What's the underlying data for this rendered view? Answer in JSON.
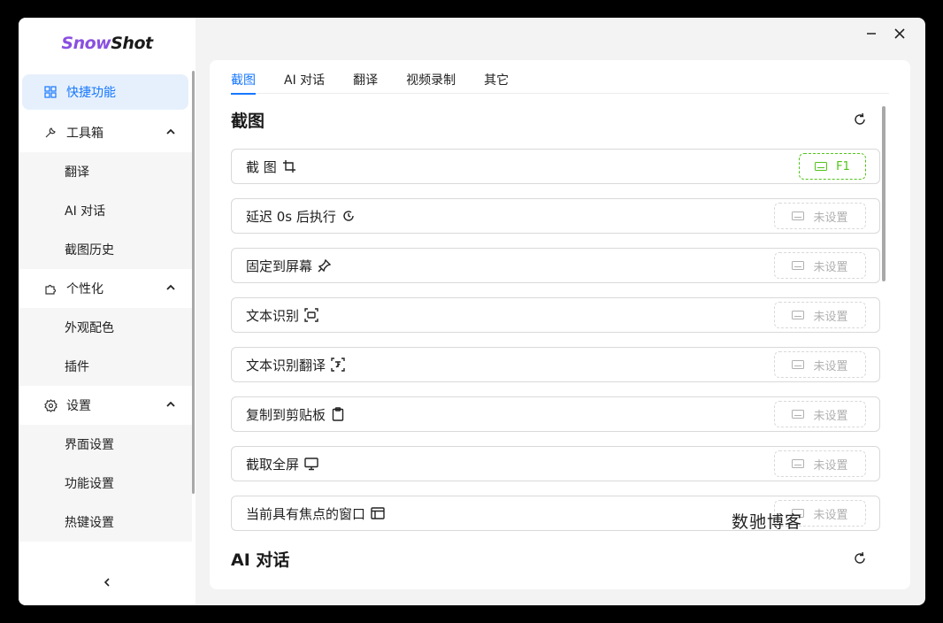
{
  "app": {
    "logo_part1": "Snow",
    "logo_part2": "Shot"
  },
  "sidebar": {
    "items": [
      {
        "label": "快捷功能",
        "icon": "grid-icon",
        "active": true
      },
      {
        "label": "工具箱",
        "icon": "wrench-icon",
        "expanded": true,
        "children": [
          "翻译",
          "AI 对话",
          "截图历史"
        ]
      },
      {
        "label": "个性化",
        "icon": "puzzle-icon",
        "expanded": true,
        "children": [
          "外观配色",
          "插件"
        ]
      },
      {
        "label": "设置",
        "icon": "gear-icon",
        "expanded": true,
        "children": [
          "界面设置",
          "功能设置",
          "热键设置"
        ]
      }
    ]
  },
  "tabs": [
    "截图",
    "AI 对话",
    "翻译",
    "视频录制",
    "其它"
  ],
  "sections": [
    {
      "title": "截图",
      "rows": [
        {
          "label": "截 图",
          "icon": "crop-icon",
          "hotkey": "F1",
          "set": true
        },
        {
          "label": "延迟 0s 后执行",
          "icon": "clock-icon",
          "hotkey": "未设置",
          "set": false
        },
        {
          "label": "固定到屏幕",
          "icon": "pin-icon",
          "hotkey": "未设置",
          "set": false
        },
        {
          "label": "文本识别",
          "icon": "scan-text-icon",
          "hotkey": "未设置",
          "set": false
        },
        {
          "label": "文本识别翻译",
          "icon": "scan-translate-icon",
          "hotkey": "未设置",
          "set": false
        },
        {
          "label": "复制到剪贴板",
          "icon": "clipboard-icon",
          "hotkey": "未设置",
          "set": false
        },
        {
          "label": "截取全屏",
          "icon": "monitor-icon",
          "hotkey": "未设置",
          "set": false
        },
        {
          "label": "当前具有焦点的窗口",
          "icon": "window-icon",
          "hotkey": "未设置",
          "set": false
        }
      ]
    },
    {
      "title": "AI 对话",
      "rows": []
    }
  ],
  "watermark": "数驰博客",
  "colors": {
    "accent": "#1677ff",
    "active_bg": "#e6f0fc",
    "hotkey_set": "#52c41a",
    "logo_purple": "#8a4fe0"
  }
}
